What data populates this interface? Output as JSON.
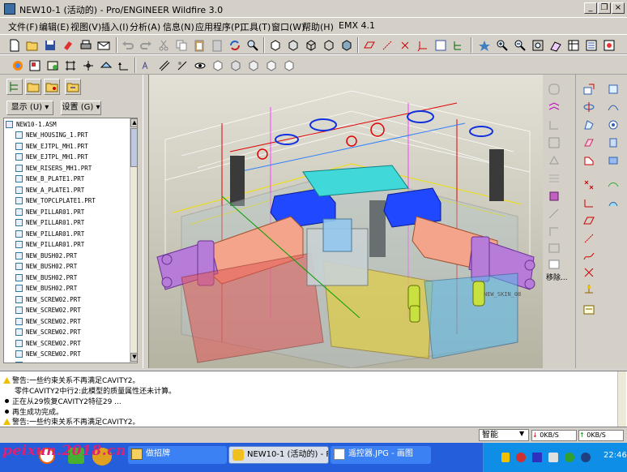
{
  "window": {
    "title": "NEW10-1 (活动的) - Pro/ENGINEER Wildfire 3.0",
    "minimize_glyph": "_",
    "restore_glyph": "❐",
    "close_glyph": "×"
  },
  "menu": [
    "文件(F)",
    "编辑(E)",
    "视图(V)",
    "插入(I)",
    "分析(A)",
    "信息(N)",
    "应用程序(P)",
    "工具(T)",
    "窗口(W)",
    "帮助(H)",
    "EMX 4.1"
  ],
  "left_panel": {
    "show_label": "显示 (U) ▾",
    "settings_label": "设置 (G) ▾",
    "tree_root": "NEW10-1.ASM",
    "tree_items": [
      "NEW_HOUSING_1.PRT",
      "NEW_EJTPL_MH1.PRT",
      "NEW_EJTPL_MH1.PRT",
      "NEW_RISERS_MH1.PRT",
      "NEW_B_PLATE1.PRT",
      "NEW_A_PLATE1.PRT",
      "NEW_TOPCLPLATE1.PRT",
      "NEW_PILLAR01.PRT",
      "NEW_PILLAR01.PRT",
      "NEW_PILLAR01.PRT",
      "NEW_PILLAR01.PRT",
      "NEW_BUSH02.PRT",
      "NEW_BUSH02.PRT",
      "NEW_BUSH02.PRT",
      "NEW_BUSH02.PRT",
      "NEW_SCREW02.PRT",
      "NEW_SCREW02.PRT",
      "NEW_SCREW02.PRT",
      "NEW_SCREW02.PRT",
      "NEW_SCREW02.PRT",
      "NEW_SCREW02.PRT",
      "NEW_SCREW02.PRT"
    ]
  },
  "right_toolbar": {
    "remove_label": "移除..."
  },
  "graphics": {
    "model_label": "NEW_SKIN_08"
  },
  "messages": [
    {
      "type": "warn",
      "text": "警告:一些约束关系不再满足CAVITY2。"
    },
    {
      "type": "info",
      "text": "零件CAVITY2中行2:此模型的质量属性还未计算。"
    },
    {
      "type": "dot",
      "text": "正在从29恢复CAVITY2特征29 ..."
    },
    {
      "type": "dot",
      "text": "再生成功完成。"
    },
    {
      "type": "warn",
      "text": "警告:一些约束关系不再满足CAVITY2。"
    }
  ],
  "status": {
    "smart_filter": "智能"
  },
  "taskbar": {
    "buttons": [
      {
        "label": "做招牌"
      },
      {
        "label": "NEW10-1 (活动的) - P..."
      },
      {
        "label": "遥控器.JPG - 画图"
      }
    ],
    "net_down": "0KB/S",
    "net_up": "0KB/S",
    "clock": "22:46"
  },
  "watermark": "peixun.2018.cn",
  "colors": {
    "titlebar": "#d4d0c8",
    "taskbar": "#245edb",
    "tray": "#0f8ee8",
    "watermark": "#e02070"
  }
}
